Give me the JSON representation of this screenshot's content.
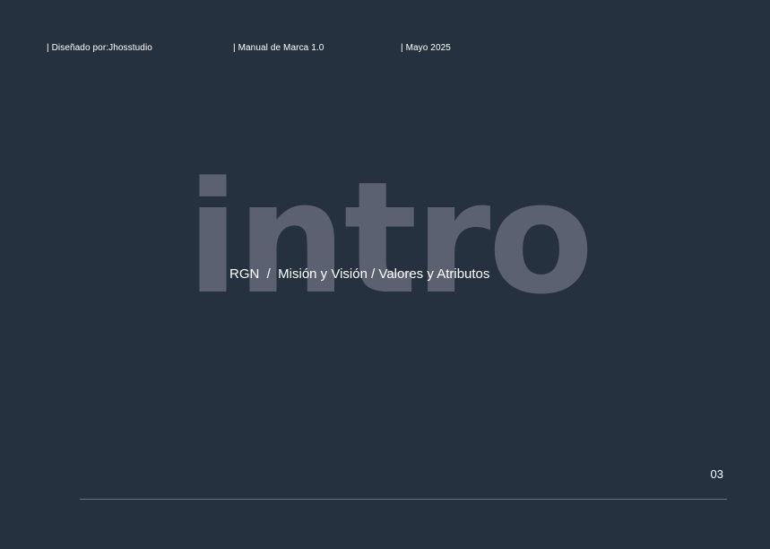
{
  "header": {
    "designer": "| Diseñado por:Jhosstudio",
    "manual": "| Manual de Marca 1.0",
    "date": "| Mayo 2025"
  },
  "hero": {
    "word": "intro",
    "subtitle": "RGN  /  Misión y Visión / Valores y Atributos"
  },
  "footer": {
    "page_number": "03"
  },
  "colors": {
    "background": "#263140",
    "hero_word": "#5b6170",
    "text": "#ffffff",
    "divider": "#6a7282"
  }
}
